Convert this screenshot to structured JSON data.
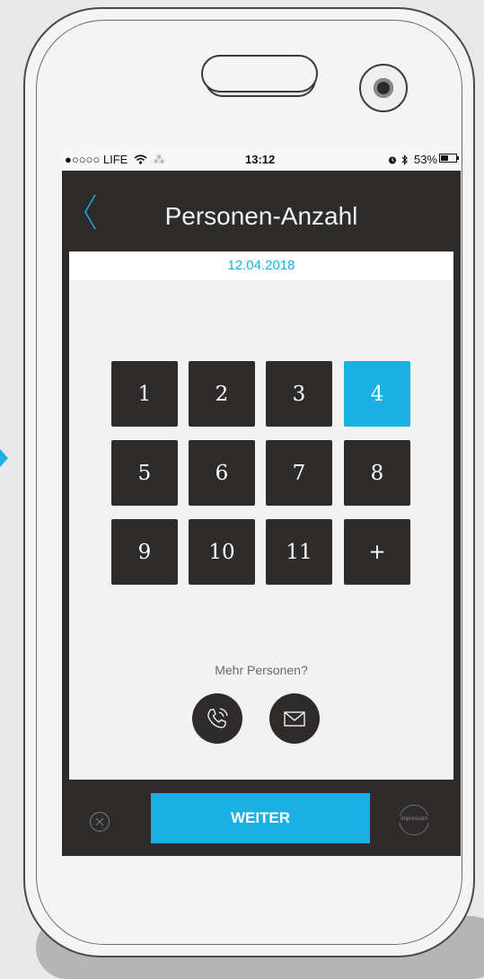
{
  "status_bar": {
    "carrier": "●○○○○ LIFE",
    "time": "13:12",
    "battery_text": "53%",
    "battery_level": 0.53
  },
  "header": {
    "title": "Personen-Anzahl"
  },
  "date": "12.04.2018",
  "keypad": {
    "buttons": [
      "1",
      "2",
      "3",
      "4",
      "5",
      "6",
      "7",
      "8",
      "9",
      "10",
      "11",
      "+"
    ],
    "selected": "4"
  },
  "more_people": {
    "label": "Mehr Personen?"
  },
  "footer": {
    "next_label": "WEITER",
    "impressum_label": "Impressum"
  },
  "colors": {
    "accent": "#1ab0e3",
    "dark": "#2e2b2b",
    "content_bg": "#f2f2f2"
  }
}
